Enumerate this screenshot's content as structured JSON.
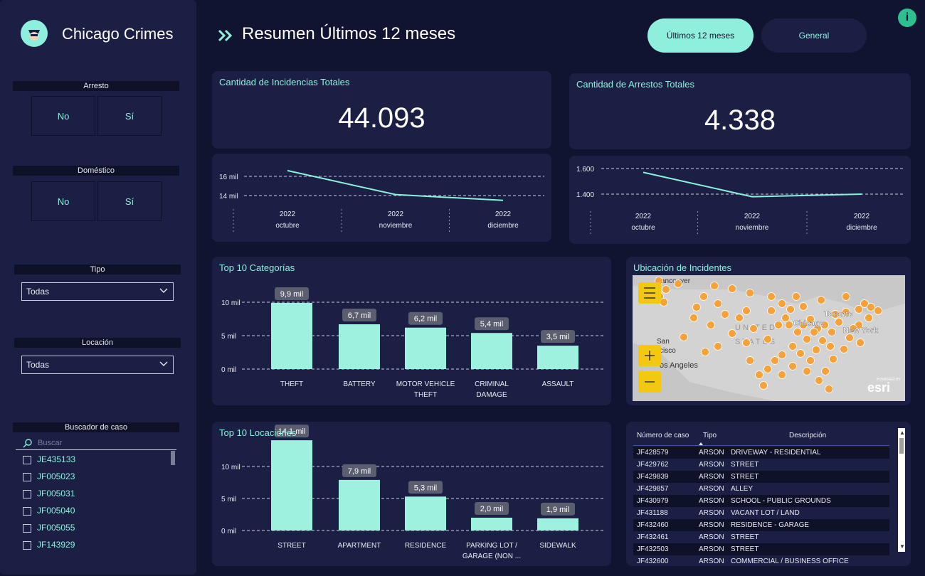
{
  "sidebar": {
    "app_title": "Chicago Crimes",
    "logo_icon": "police-officer-icon",
    "arresto": {
      "label": "Arresto",
      "options": [
        "No",
        "Sí"
      ]
    },
    "domestico": {
      "label": "Doméstico",
      "options": [
        "No",
        "Sí"
      ]
    },
    "tipo": {
      "label": "Tipo",
      "value": "Todas"
    },
    "locacion": {
      "label": "Locación",
      "value": "Todas"
    },
    "buscador": {
      "label": "Buscador de caso",
      "placeholder": "Buscar",
      "cases": [
        "JE435133",
        "JF005023",
        "JF005031",
        "JF005040",
        "JF005055",
        "JF143929"
      ]
    }
  },
  "header": {
    "title": "Resumen Últimos 12 meses",
    "btn_active": "Últimos 12 meses",
    "btn_general": "General",
    "info_icon": "info-icon"
  },
  "kpi": {
    "incidencias": {
      "title": "Cantidad de Incidencias Totales",
      "value": "44.093"
    },
    "arrestos": {
      "title": "Cantidad de Arrestos Totales",
      "value": "4.338"
    }
  },
  "trend_incidencias": {
    "y_ticks": [
      "16 mil",
      "14 mil"
    ],
    "x": [
      {
        "year": "2022",
        "month": "octubre"
      },
      {
        "year": "2022",
        "month": "noviembre"
      },
      {
        "year": "2022",
        "month": "diciembre"
      }
    ],
    "values": [
      16600,
      14100,
      13500
    ]
  },
  "trend_arrestos": {
    "y_ticks": [
      "1.600",
      "1.400"
    ],
    "x": [
      {
        "year": "2022",
        "month": "octubre"
      },
      {
        "year": "2022",
        "month": "noviembre"
      },
      {
        "year": "2022",
        "month": "diciembre"
      }
    ],
    "values": [
      1570,
      1380,
      1400
    ]
  },
  "chart_data": [
    {
      "type": "bar",
      "title": "Top 10 Categorías",
      "categories": [
        "THEFT",
        "BATTERY",
        "MOTOR VEHICLE THEFT",
        "CRIMINAL DAMAGE",
        "ASSAULT"
      ],
      "category_lines": [
        [
          "THEFT"
        ],
        [
          "BATTERY"
        ],
        [
          "MOTOR VEHICLE",
          "THEFT"
        ],
        [
          "CRIMINAL",
          "DAMAGE"
        ],
        [
          "ASSAULT"
        ]
      ],
      "values": [
        9.9,
        6.7,
        6.2,
        5.4,
        3.5
      ],
      "data_labels": [
        "9,9 mil",
        "6,7 mil",
        "6,2 mil",
        "5,4 mil",
        "3,5 mil"
      ],
      "y_ticks": [
        "10 mil",
        "5 mil",
        "0 mil"
      ],
      "ylim": [
        0,
        10
      ]
    },
    {
      "type": "bar",
      "title": "Top 10 Locaciones",
      "categories": [
        "STREET",
        "APARTMENT",
        "RESIDENCE",
        "PARKING LOT / GARAGE (NON ...",
        "SIDEWALK"
      ],
      "category_lines": [
        [
          "STREET"
        ],
        [
          "APARTMENT"
        ],
        [
          "RESIDENCE"
        ],
        [
          "PARKING LOT /",
          "GARAGE (NON ..."
        ],
        [
          "SIDEWALK"
        ]
      ],
      "values": [
        14.1,
        7.9,
        5.3,
        2.0,
        1.9
      ],
      "data_labels": [
        "14,1 mil",
        "7,9 mil",
        "5,3 mil",
        "2,0 mil",
        "1,9 mil"
      ],
      "y_ticks": [
        "10 mil",
        "5 mil",
        "0 mil"
      ],
      "ylim": [
        0,
        10
      ]
    }
  ],
  "map": {
    "title": "Ubicación de Incidentes",
    "labels": {
      "vancouver": "Vancouver",
      "san": "San",
      "francisco": "cisco",
      "los_angeles": "os Angeles",
      "united": "UNITED",
      "states": "STATES",
      "chicago": "Chicago",
      "toronto": "Toronto",
      "new_york": "New York",
      "esri": "esri",
      "powered": "POWERED BY"
    },
    "dot_color": "#f5a23a"
  },
  "table": {
    "headers": [
      "Número de caso",
      "Tipo",
      "Descripción"
    ],
    "rows": [
      [
        "JF428579",
        "ARSON",
        "DRIVEWAY - RESIDENTIAL"
      ],
      [
        "JF429762",
        "ARSON",
        "STREET"
      ],
      [
        "JF429839",
        "ARSON",
        "STREET"
      ],
      [
        "JF429857",
        "ARSON",
        "ALLEY"
      ],
      [
        "JF430979",
        "ARSON",
        "SCHOOL - PUBLIC GROUNDS"
      ],
      [
        "JF431188",
        "ARSON",
        "VACANT LOT / LAND"
      ],
      [
        "JF432460",
        "ARSON",
        "RESIDENCE - GARAGE"
      ],
      [
        "JF432461",
        "ARSON",
        "STREET"
      ],
      [
        "JF432503",
        "ARSON",
        "STREET"
      ],
      [
        "JF432600",
        "ARSON",
        "COMMERCIAL / BUSINESS OFFICE"
      ]
    ]
  },
  "colors": {
    "accent": "#8ef0dc",
    "bg": "#101430",
    "card": "#1b1f44"
  }
}
